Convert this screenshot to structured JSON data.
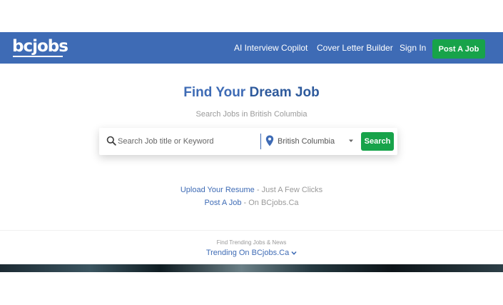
{
  "brand": {
    "logo_text": "bcjobs"
  },
  "nav": {
    "links": [
      "AI Interview Copilot",
      "Cover Letter Builder",
      "Sign In"
    ],
    "post_job_label": "Post A Job"
  },
  "hero": {
    "title_prefix": "Find Your ",
    "title_bold": "Dream Job",
    "subtitle": "Search Jobs in British Columbia"
  },
  "search": {
    "keyword_placeholder": "Search Job title or Keyword",
    "location_value": "British Columbia",
    "button_label": "Search"
  },
  "promo": {
    "upload_link": "Upload Your Resume",
    "upload_rest": " - Just A Few Clicks",
    "post_link": "Post A Job",
    "post_rest": " - On BCjobs.Ca"
  },
  "trending": {
    "small_text": "Find Trending Jobs & News",
    "label": "Trending On BCjobs.Ca"
  },
  "colors": {
    "brand_blue": "#3e6bb5",
    "action_green": "#17a34a"
  },
  "icons": {
    "search": "search-icon",
    "location": "map-pin-icon",
    "dropdown": "chevron-down-icon"
  }
}
